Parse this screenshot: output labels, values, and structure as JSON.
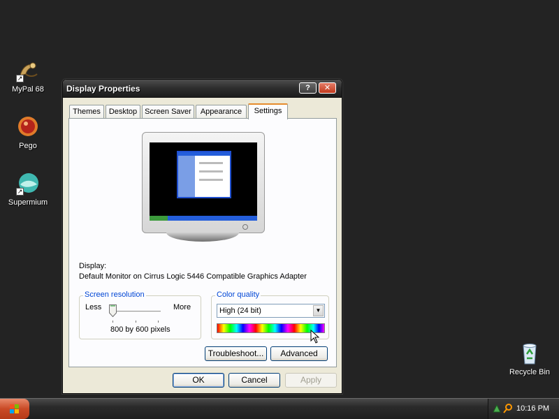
{
  "desktop": {
    "icons": [
      {
        "label": "MyPal 68",
        "icon": "mypal-icon"
      },
      {
        "label": "Pego",
        "icon": "pego-icon"
      },
      {
        "label": "Supermium",
        "icon": "supermium-icon"
      },
      {
        "label": "Recycle Bin",
        "icon": "recycle-bin-icon"
      }
    ]
  },
  "window": {
    "title": "Display Properties",
    "help_label": "?",
    "close_label": "✕",
    "tabs": [
      {
        "label": "Themes"
      },
      {
        "label": "Desktop"
      },
      {
        "label": "Screen Saver"
      },
      {
        "label": "Appearance"
      },
      {
        "label": "Settings",
        "active": true
      }
    ],
    "display_label": "Display:",
    "display_value": "Default Monitor on Cirrus Logic 5446 Compatible Graphics Adapter",
    "resolution": {
      "legend": "Screen resolution",
      "less": "Less",
      "more": "More",
      "value": "800 by 600 pixels",
      "slider_level": 0.0
    },
    "color_quality": {
      "legend": "Color quality",
      "selected": "High (24 bit)"
    },
    "buttons": {
      "troubleshoot": "Troubleshoot...",
      "advanced": "Advanced",
      "ok": "OK",
      "cancel": "Cancel",
      "apply": "Apply"
    }
  },
  "taskbar": {
    "clock": "10:16 PM"
  },
  "colors": {
    "accent_tab": "#e68b2c",
    "group_legend": "#0046d5",
    "start_button": "#c94a26"
  }
}
